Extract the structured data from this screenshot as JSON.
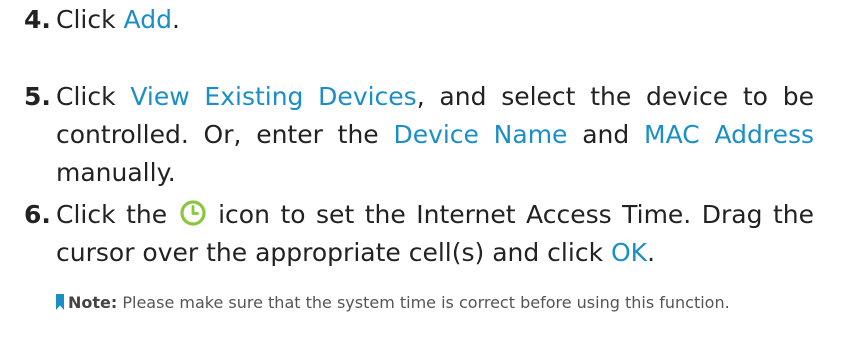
{
  "steps": [
    {
      "number": "4.",
      "t1": "Click ",
      "l1": "Add",
      "t2": "."
    },
    {
      "number": "5.",
      "t1": "Click ",
      "l1": "View Existing Devices",
      "t2": ", and select the device to be controlled. Or, enter the ",
      "l2": "Device Name",
      "t3": " and ",
      "l3": "MAC Address",
      "t4": " manually."
    },
    {
      "number": "6.",
      "t1": "Click the ",
      "t2": " icon to set the Internet Access Time. Drag the cursor over the appropriate cell(s) and click ",
      "l1": "OK",
      "t3": "."
    }
  ],
  "note": {
    "label": "Note:",
    "text": " Please make sure that the system time is correct before using this function."
  },
  "colors": {
    "link": "#1a8fc7",
    "clock_icon": "#8cc63f",
    "note_flag": "#1a8fc7"
  },
  "icons": {
    "clock": "clock-icon",
    "note_flag": "bookmark-flag-icon"
  }
}
